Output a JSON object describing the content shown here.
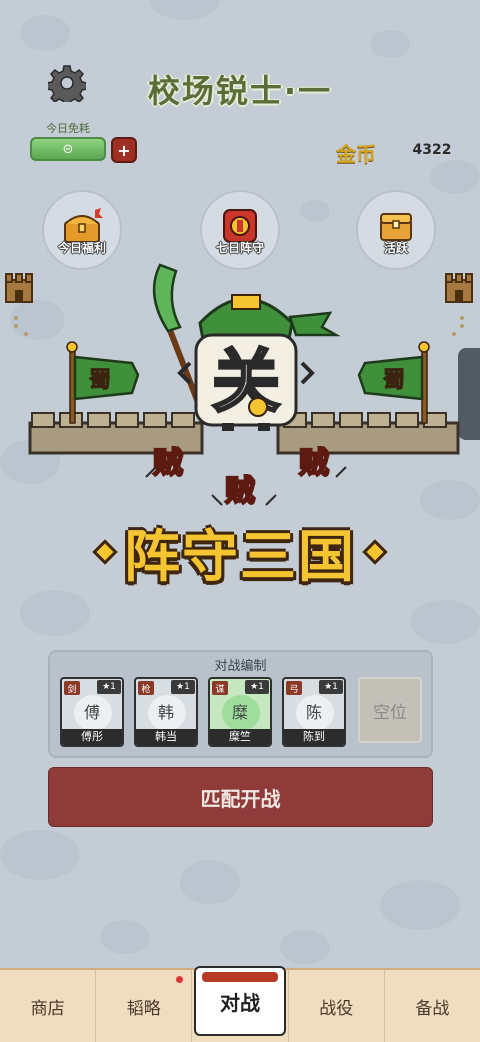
{
  "header": {
    "title": "校场锐士·一",
    "free_today_label": "今日免耗",
    "coin_label": "金币",
    "coin_value": "4322"
  },
  "quick_actions": [
    {
      "label": "今日福利",
      "icon": "treasure-chest-icon"
    },
    {
      "label": "七日阵守",
      "icon": "seven-day-badge-icon"
    },
    {
      "label": "活跃",
      "icon": "activity-chest-icon"
    }
  ],
  "scene": {
    "hero_character": "关",
    "flag_text": "蜀",
    "enemy_text": "贼"
  },
  "logo": {
    "text": "阵守三国"
  },
  "lineup": {
    "title": "对战编制",
    "cards": [
      {
        "type": "剑",
        "stars": "★1",
        "glyph": "傅",
        "name": "傅彤",
        "highlight": false
      },
      {
        "type": "枪",
        "stars": "★1",
        "glyph": "韩",
        "name": "韩当",
        "highlight": false
      },
      {
        "type": "谋",
        "stars": "★1",
        "glyph": "糜",
        "name": "糜竺",
        "highlight": true
      },
      {
        "type": "弓",
        "stars": "★1",
        "glyph": "陈",
        "name": "陈到",
        "highlight": false
      }
    ],
    "empty_slot_label": "空位"
  },
  "match_button": {
    "label": "匹配开战"
  },
  "nav": {
    "items": [
      "商店",
      "韬略",
      "对战",
      "战役",
      "备战"
    ],
    "active": "对战"
  },
  "colors": {
    "background": "#c4cdd6",
    "title_green": "#5d6d3a",
    "coin_gold": "#d2a42a",
    "logo_gold": "#f5c531",
    "match_red": "#8e3b3a",
    "nav_bg": "#f0dcbf"
  }
}
